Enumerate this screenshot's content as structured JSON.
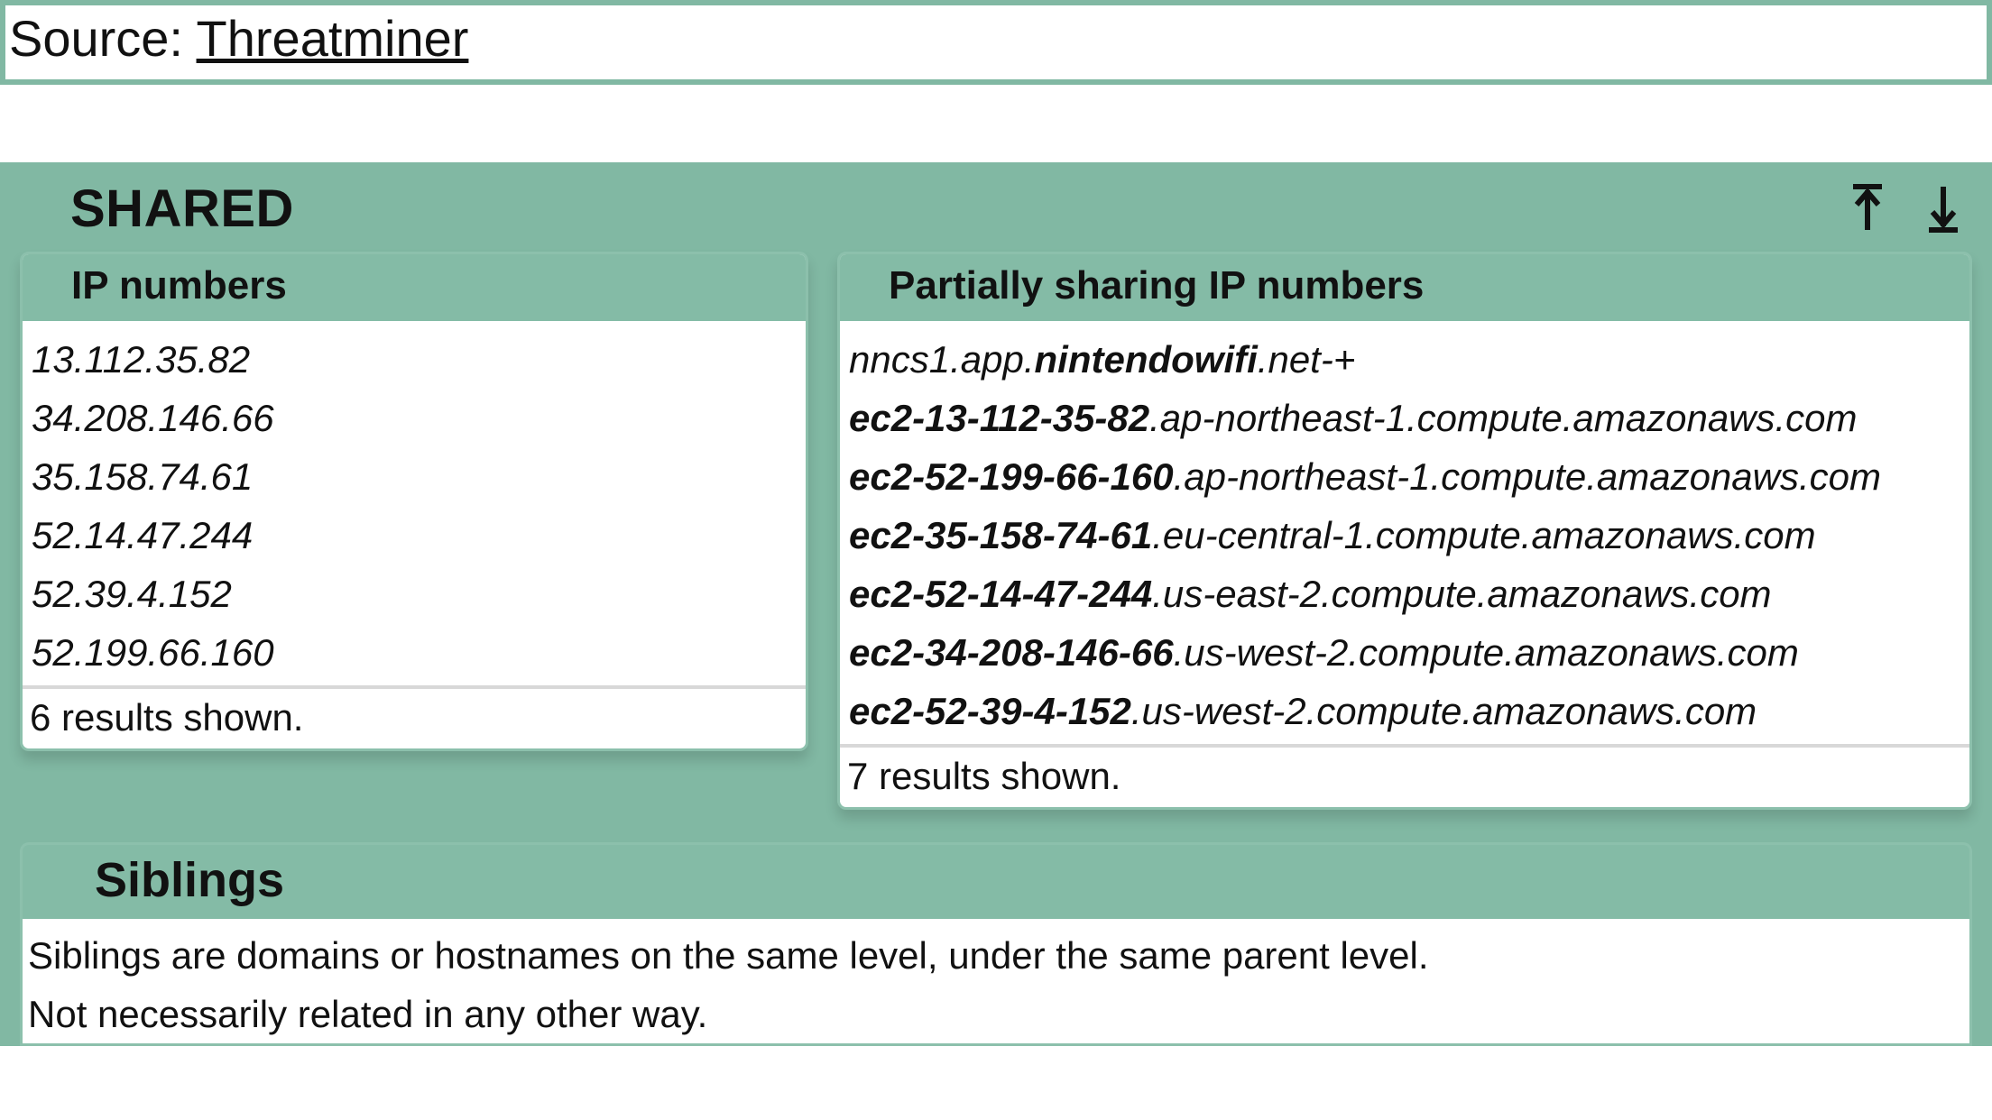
{
  "source": {
    "label": "Source: ",
    "link_text": "Threatminer"
  },
  "shared": {
    "title": "SHARED",
    "panels": {
      "ip": {
        "title": "IP numbers",
        "rows": [
          "13.112.35.82",
          "34.208.146.66",
          "35.158.74.61",
          "52.14.47.244",
          "52.39.4.152",
          "52.199.66.160"
        ],
        "footer": "6 results shown."
      },
      "partial": {
        "title": "Partially sharing IP numbers",
        "rows": [
          {
            "pre": "nncs1.app.",
            "bold": "nintendowifi",
            "post": ".net-+"
          },
          {
            "pre": "",
            "bold": "ec2-13-112-35-82",
            "post": ".ap-northeast-1.compute.amazonaws.com"
          },
          {
            "pre": "",
            "bold": "ec2-52-199-66-160",
            "post": ".ap-northeast-1.compute.amazonaws.com"
          },
          {
            "pre": "",
            "bold": "ec2-35-158-74-61",
            "post": ".eu-central-1.compute.amazonaws.com"
          },
          {
            "pre": "",
            "bold": "ec2-52-14-47-244",
            "post": ".us-east-2.compute.amazonaws.com"
          },
          {
            "pre": "",
            "bold": "ec2-34-208-146-66",
            "post": ".us-west-2.compute.amazonaws.com"
          },
          {
            "pre": "",
            "bold": "ec2-52-39-4-152",
            "post": ".us-west-2.compute.amazonaws.com"
          }
        ],
        "footer": "7 results shown."
      }
    }
  },
  "siblings": {
    "title": "Siblings",
    "line1": "Siblings are domains or hostnames on the same level, under the same parent level.",
    "line2": "Not necessarily related in any other way."
  }
}
